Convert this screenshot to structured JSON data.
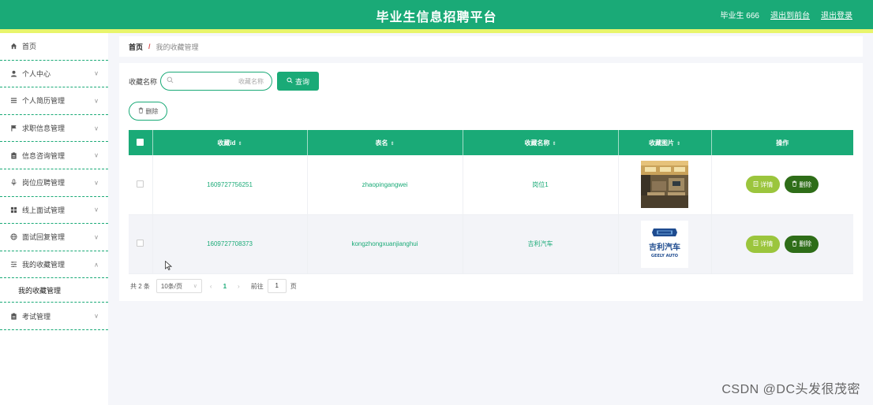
{
  "header": {
    "title": "毕业生信息招聘平台",
    "user": "毕业生 666",
    "back_label": "退出到前台",
    "logout_label": "退出登录"
  },
  "sidebar": {
    "items": [
      {
        "label": "首页",
        "icon": "home-icon",
        "has_chevron": false
      },
      {
        "label": "个人中心",
        "icon": "user-icon",
        "has_chevron": true
      },
      {
        "label": "个人简历管理",
        "icon": "list-icon",
        "has_chevron": true
      },
      {
        "label": "求职信息管理",
        "icon": "flag-icon",
        "has_chevron": true
      },
      {
        "label": "信息咨询管理",
        "icon": "clipboard-icon",
        "has_chevron": true
      },
      {
        "label": "岗位应聘管理",
        "icon": "mic-icon",
        "has_chevron": true
      },
      {
        "label": "线上面试管理",
        "icon": "grid-icon",
        "has_chevron": true
      },
      {
        "label": "面试回复管理",
        "icon": "globe-icon",
        "has_chevron": true
      },
      {
        "label": "我的收藏管理",
        "icon": "sliders-icon",
        "has_chevron": true,
        "expanded": true
      },
      {
        "label": "考试管理",
        "icon": "clipboard-icon",
        "has_chevron": true
      }
    ],
    "submenu_label": "我的收藏管理"
  },
  "breadcrumb": {
    "home": "首页",
    "separator": "/",
    "current": "我的收藏管理"
  },
  "search": {
    "label": "收藏名称",
    "placeholder": "收藏名称",
    "query_label": "查询"
  },
  "toolbar": {
    "delete_label": "删除"
  },
  "table": {
    "columns": [
      "收藏id",
      "表名",
      "收藏名称",
      "收藏图片",
      "操作"
    ],
    "rows": [
      {
        "id": "1609727756251",
        "table_name": "zhaopingangwei",
        "name": "岗位1",
        "image": "office-photo"
      },
      {
        "id": "1609727708373",
        "table_name": "kongzhongxuanjianghui",
        "name": "吉利汽车",
        "image": "geely-logo"
      }
    ],
    "detail_label": "详情",
    "delete_label": "删除"
  },
  "geely_logo": {
    "cn": "吉利汽车",
    "en": "GEELY AUTO"
  },
  "pagination": {
    "total_prefix": "共 2 条",
    "page_size": "10条/页",
    "current_page": "1",
    "jump_prefix": "前往",
    "jump_value": "1",
    "jump_suffix": "页"
  },
  "colors": {
    "primary": "#1aaa77",
    "accent_bar": "#e8f56b",
    "detail_button": "#9bc53d",
    "delete_button": "#2e6d18"
  },
  "watermark": "CSDN @DC头发很茂密"
}
